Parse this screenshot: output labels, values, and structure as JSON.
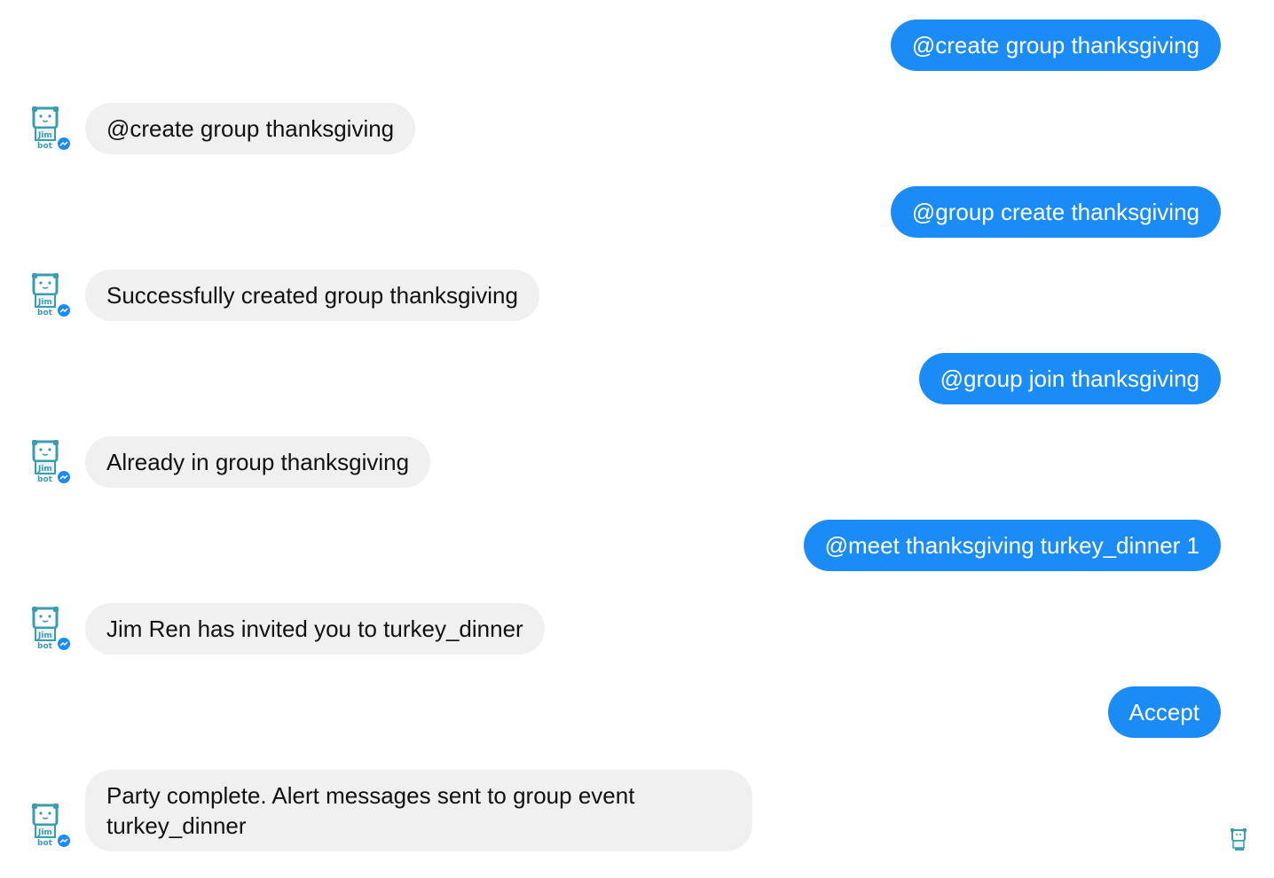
{
  "colors": {
    "outgoing_bubble": "#1b8cf5",
    "incoming_bubble": "#f0f0f0",
    "messenger_badge": "#1b8cf5",
    "bot_avatar": "#3b9bb0"
  },
  "bot": {
    "avatar_icon": "jimbot-robot-icon",
    "badge_icon": "messenger-badge-icon",
    "avatar_text_line1": "Jim",
    "avatar_text_line2": "bot"
  },
  "messages": [
    {
      "sender": "user",
      "text": "@create group thanksgiving"
    },
    {
      "sender": "bot",
      "text": "@create group thanksgiving"
    },
    {
      "sender": "user",
      "text": "@group create thanksgiving"
    },
    {
      "sender": "bot",
      "text": "Successfully created group thanksgiving"
    },
    {
      "sender": "user",
      "text": "@group join thanksgiving"
    },
    {
      "sender": "bot",
      "text": "Already in group thanksgiving"
    },
    {
      "sender": "user",
      "text": "@meet thanksgiving turkey_dinner 1"
    },
    {
      "sender": "bot",
      "text": "Jim Ren has invited you to turkey_dinner"
    },
    {
      "sender": "user",
      "text": "Accept"
    },
    {
      "sender": "bot",
      "text": "Party complete. Alert messages sent to group event turkey_dinner"
    }
  ],
  "read_receipt_icon": "seen-avatar-icon"
}
